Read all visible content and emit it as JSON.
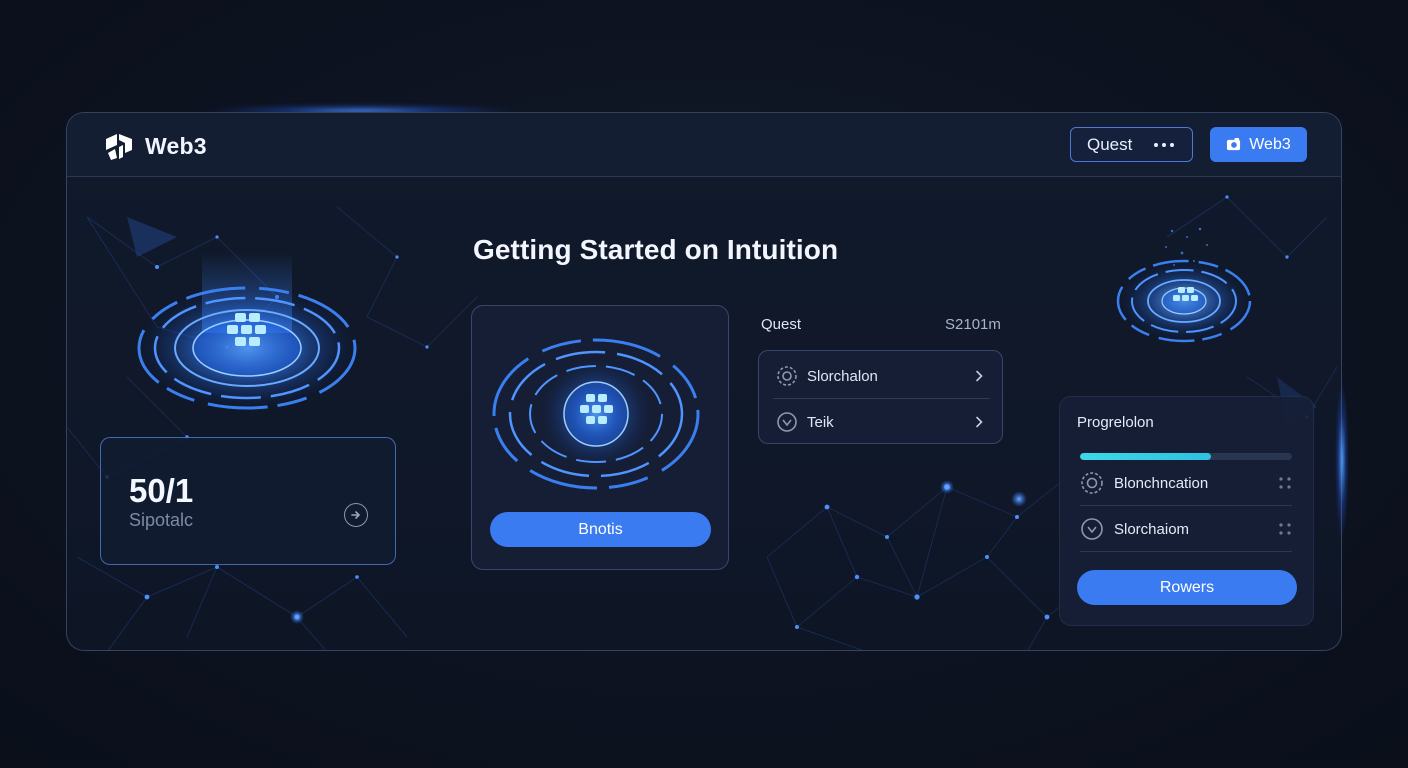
{
  "app": {
    "brand_name": "Web3",
    "brand_icon": "web3-logo-icon"
  },
  "header": {
    "quest_button_label": "Quest",
    "quest_menu_icon": "more-dots-icon",
    "web3_button_label": "Web3",
    "web3_button_icon": "wallet-icon"
  },
  "main": {
    "title": "Getting Started on Intuition"
  },
  "stat_card": {
    "value": "50/1",
    "label": "Sipotalc",
    "action_icon": "arrow-circle-icon"
  },
  "center_card": {
    "button_label": "Bnotis",
    "art_icon": "blockchain-cube-icon"
  },
  "quest_panel": {
    "header": "Quest",
    "meta": "S2101m",
    "items": [
      {
        "label": "Slorchalon",
        "icon": "gear-icon"
      },
      {
        "label": "Teik",
        "icon": "shield-icon"
      }
    ]
  },
  "progress_panel": {
    "title": "Progrelolon",
    "progress": 0.62,
    "items": [
      {
        "label": "Blonchncation",
        "icon": "gear-icon"
      },
      {
        "label": "Slorchaiom",
        "icon": "shield-icon"
      }
    ],
    "button_label": "Rowers"
  },
  "colors": {
    "accent": "#3a7bf2",
    "progress": "#3dd8e8",
    "background": "#0d1320",
    "panel": "#161f36"
  }
}
